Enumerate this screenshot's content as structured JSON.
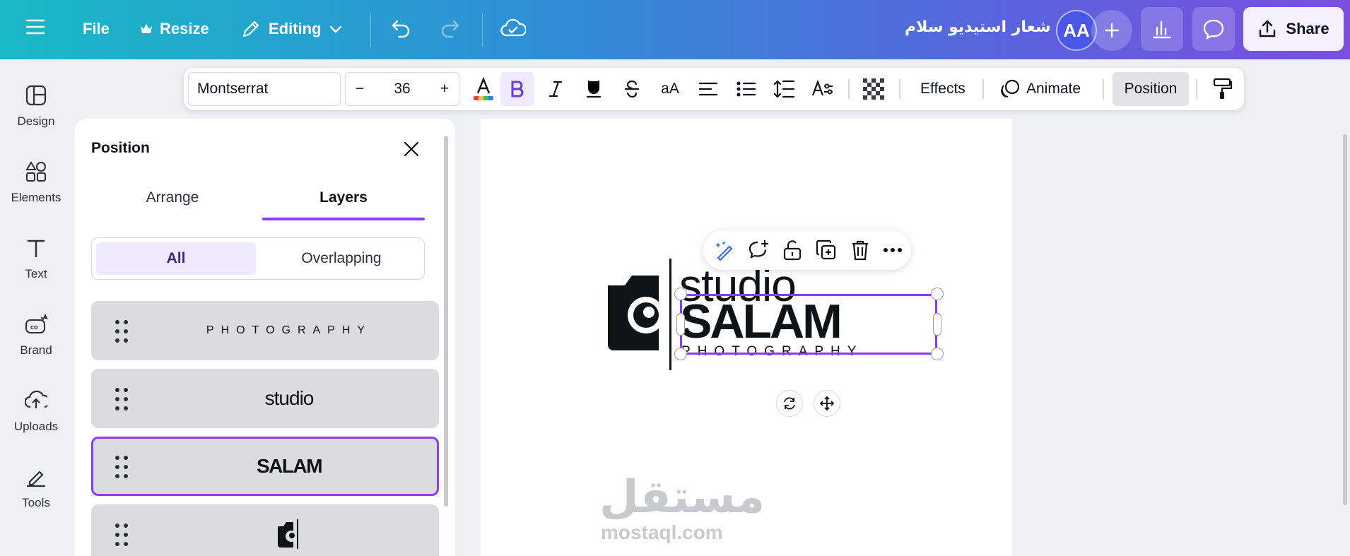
{
  "topbar": {
    "file_label": "File",
    "resize_label": "Resize",
    "mode_label": "Editing",
    "doc_title": "شعار استيديو سلام",
    "avatar_initials": "AA",
    "share_label": "Share"
  },
  "rail": {
    "items": [
      {
        "label": "Design",
        "icon": "design-icon"
      },
      {
        "label": "Elements",
        "icon": "elements-icon"
      },
      {
        "label": "Text",
        "icon": "text-icon"
      },
      {
        "label": "Brand",
        "icon": "brand-icon"
      },
      {
        "label": "Uploads",
        "icon": "uploads-icon"
      },
      {
        "label": "Tools",
        "icon": "tools-icon"
      }
    ]
  },
  "panel": {
    "title": "Position",
    "tabs": [
      "Arrange",
      "Layers"
    ],
    "active_tab": "Layers",
    "filters": [
      "All",
      "Overlapping"
    ],
    "active_filter": "All",
    "layers": [
      {
        "text": "PHOTOGRAPHY",
        "selected": false
      },
      {
        "text": "studio",
        "selected": false
      },
      {
        "text": "SALAM",
        "selected": true
      },
      {
        "text": "",
        "icon": "camera-logo-icon",
        "selected": false
      }
    ]
  },
  "toolbar": {
    "font": "Montserrat",
    "size": "36",
    "minus": "−",
    "plus": "+",
    "effects_label": "Effects",
    "animate_label": "Animate",
    "position_label": "Position",
    "case_label": "aA"
  },
  "canvas": {
    "logo_word1": "studio",
    "logo_word2": "SALAM",
    "logo_word3": "PHOTOGRAPHY",
    "watermark_arabic": "مستقل",
    "watermark_latin": "mostaql.com"
  },
  "colors": {
    "accent": "#8b3dff",
    "topbar_start": "#19b9c6",
    "topbar_end": "#7a4fe0"
  }
}
